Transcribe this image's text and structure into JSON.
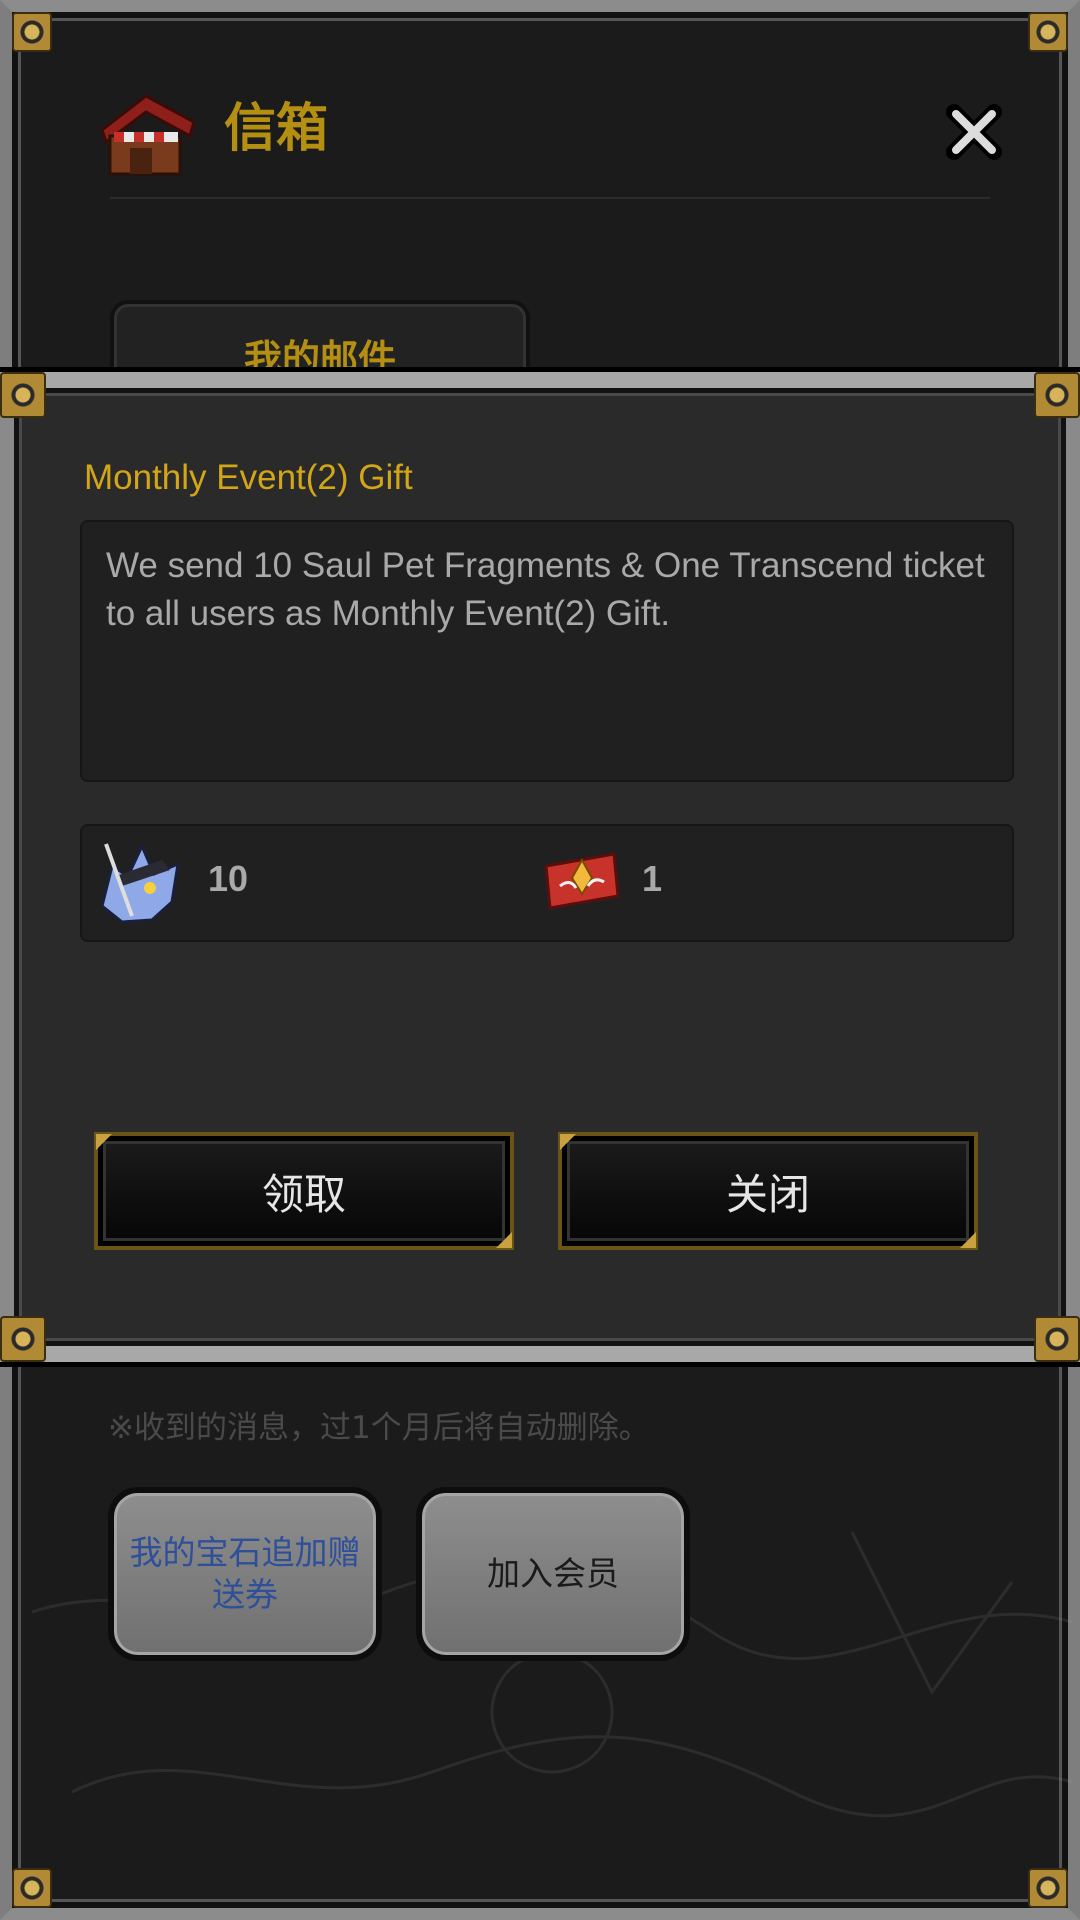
{
  "mailbox": {
    "title": "信箱",
    "tab_label": "我的邮件",
    "notice": "※收到的消息，过1个月后将自动删除。",
    "buttons": {
      "gem_voucher": "我的宝石追加赠送券",
      "join_member": "加入会员"
    },
    "icons": {
      "header": "shop-house-icon",
      "close": "close-x-icon"
    }
  },
  "modal": {
    "title": "Monthly Event(2) Gift",
    "message": "We send 10 Saul Pet Fragments & One Transcend ticket to all users as Monthly Event(2) Gift.",
    "rewards": [
      {
        "icon": "saul-pet-fragment-icon",
        "quantity": "10"
      },
      {
        "icon": "transcend-ticket-icon",
        "quantity": "1"
      }
    ],
    "buttons": {
      "claim": "领取",
      "close": "关闭"
    }
  },
  "colors": {
    "gold_title": "#b58f12",
    "gift_title": "#d3a617",
    "panel_bg": "#2a2a2a",
    "blue_text": "#2e4f9a"
  }
}
